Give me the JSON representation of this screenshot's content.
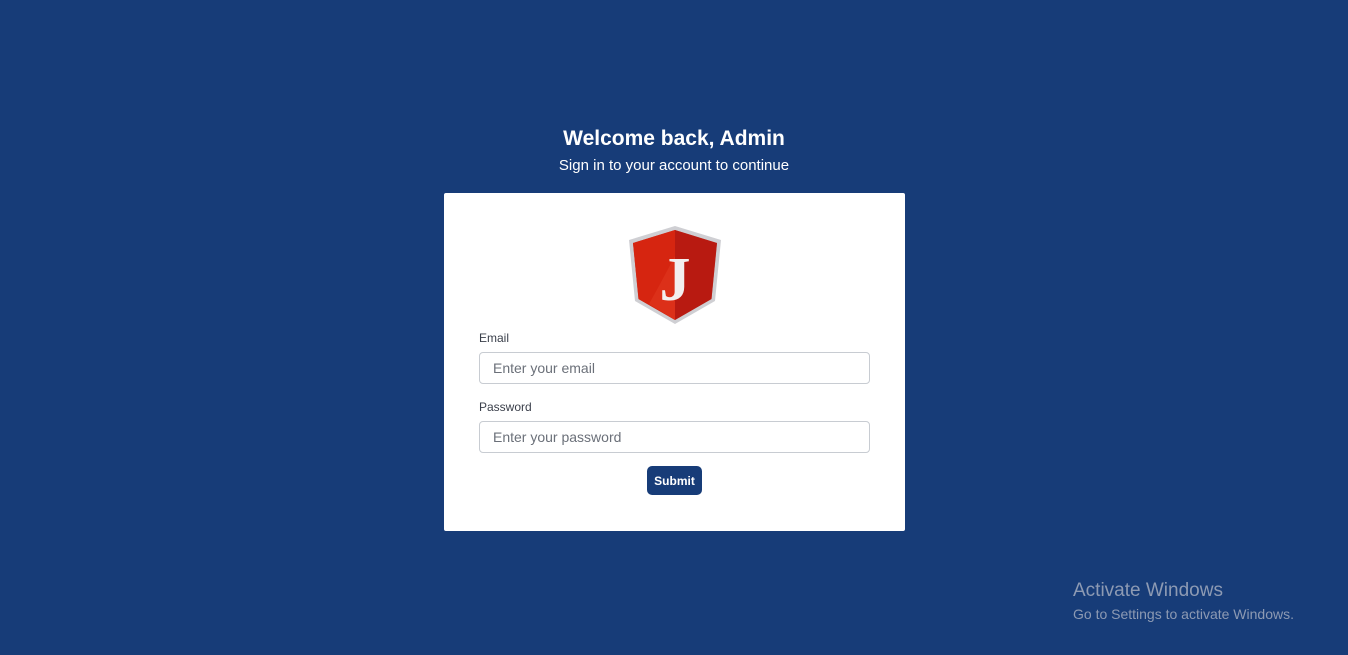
{
  "header": {
    "title": "Welcome back, Admin",
    "subtitle": "Sign in to your account to continue"
  },
  "logo": {
    "icon": "j-shield-logo-icon",
    "letter": "J"
  },
  "form": {
    "email": {
      "label": "Email",
      "value": "",
      "placeholder": "Enter your email"
    },
    "password": {
      "label": "Password",
      "value": "",
      "placeholder": "Enter your password"
    },
    "submit_label": "Submit"
  },
  "watermark": {
    "title": "Activate Windows",
    "subtitle": "Go to Settings to activate Windows."
  },
  "colors": {
    "background": "#173c78",
    "card": "#ffffff",
    "button": "#173c78",
    "logo_red": "#c41e14"
  }
}
